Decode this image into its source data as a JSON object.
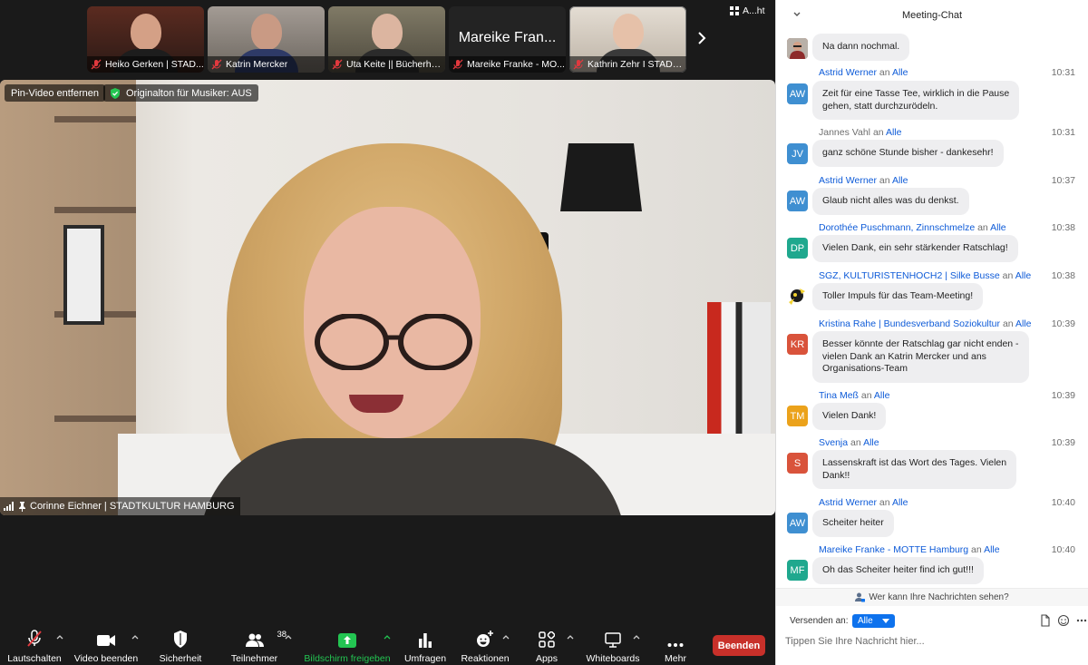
{
  "thumbnails": [
    {
      "name": "Heiko Gerken | STAD...",
      "muted": true
    },
    {
      "name": "Katrin Mercker",
      "muted": true
    },
    {
      "name": "Uta Keite || Bücherhal...",
      "muted": true
    },
    {
      "name": "Mareike Franke - MO...",
      "muted": true,
      "big_name": "Mareike Fran..."
    },
    {
      "name": "Kathrin Zehr I STADK...",
      "muted": true
    }
  ],
  "top_right_label": "A...ht",
  "main_video": {
    "pin_label": "Pin-Video entfernen",
    "original_sound": "Originalton für Musiker: AUS",
    "speaker_name": "Corinne Eichner | STADTKULTUR HAMBURG"
  },
  "toolbar": {
    "unmute": "Lautschalten",
    "stop_video": "Video beenden",
    "security": "Sicherheit",
    "participants": "Teilnehmer",
    "participant_count": "38",
    "share_screen": "Bildschirm freigeben",
    "polls": "Umfragen",
    "reactions": "Reaktionen",
    "apps": "Apps",
    "whiteboards": "Whiteboards",
    "more": "Mehr",
    "end": "Beenden"
  },
  "chat": {
    "title": "Meeting-Chat",
    "to_word": "an",
    "messages": [
      {
        "sender": "",
        "to": "",
        "time": "",
        "avatar": "photo",
        "avatar_color": "#a24d3a",
        "lines": [
          "Na dann nochmal."
        ]
      },
      {
        "sender": "Astrid Werner",
        "to": "Alle",
        "time": "10:31",
        "avatar": "AW",
        "avatar_color": "#3f8fd1",
        "lines": [
          "Zeit für eine Tasse Tee, wirklich in die Pause",
          "gehen, statt durchzurödeln."
        ]
      },
      {
        "sender": "Jannes Vahl",
        "to": "Alle",
        "time": "10:31",
        "avatar": "JV",
        "avatar_color": "#3f8fd1",
        "lines": [
          "ganz schöne Stunde bisher - dankesehr!"
        ]
      },
      {
        "sender": "Astrid Werner",
        "to": "Alle",
        "time": "10:37",
        "avatar": "AW",
        "avatar_color": "#3f8fd1",
        "lines": [
          "Glaub nicht alles was du denkst."
        ]
      },
      {
        "sender": "Dorothée Puschmann, Zinnschmelze",
        "to": "Alle",
        "time": "10:38",
        "avatar": "DP",
        "avatar_color": "#1fa88e",
        "lines": [
          "Vielen Dank, ein sehr stärkender Ratschlag!"
        ]
      },
      {
        "sender": "SGZ, KULTURISTENHOCH2  | Silke Busse",
        "to": "Alle",
        "time": "10:38",
        "avatar": "photo2",
        "avatar_color": "#f2d230",
        "lines": [
          "Toller Impuls für das Team-Meeting!"
        ]
      },
      {
        "sender": "Kristina Rahe | Bundesverband Soziokultur",
        "to": "Alle",
        "time": "10:39",
        "avatar": "KR",
        "avatar_color": "#d9533b",
        "lines": [
          "Besser könnte der Ratschlag gar nicht enden -",
          "vielen Dank an Katrin Mercker und ans",
          "Organisations-Team"
        ]
      },
      {
        "sender": "Tina Meß",
        "to": "Alle",
        "time": "10:39",
        "avatar": "TM",
        "avatar_color": "#eba21b",
        "lines": [
          "Vielen Dank!"
        ]
      },
      {
        "sender": "Svenja",
        "to": "Alle",
        "time": "10:39",
        "avatar": "S",
        "avatar_color": "#d9533b",
        "lines": [
          "Lassenskraft ist das Wort des Tages. Vielen",
          "Dank!!"
        ]
      },
      {
        "sender": "Astrid Werner",
        "to": "Alle",
        "time": "10:40",
        "avatar": "AW",
        "avatar_color": "#3f8fd1",
        "lines": [
          "Scheiter heiter"
        ]
      },
      {
        "sender": "Mareike Franke - MOTTE Hamburg",
        "to": "Alle",
        "time": "10:40",
        "avatar": "MF",
        "avatar_color": "#1fa88e",
        "lines": [
          "Oh das Scheiter heiter find ich gut!!!"
        ]
      }
    ],
    "who_can_see": "Wer kann Ihre Nachrichten sehen?",
    "send_to_label": "Versenden an:",
    "recipient": "Alle",
    "input_placeholder": "Tippen Sie Ihre Nachricht hier..."
  },
  "colors": {
    "accent_blue": "#0e72ed",
    "link_blue": "#0e5bd8",
    "end_red": "#c8302a",
    "share_green": "#23c552",
    "mute_red": "#e0393e"
  }
}
